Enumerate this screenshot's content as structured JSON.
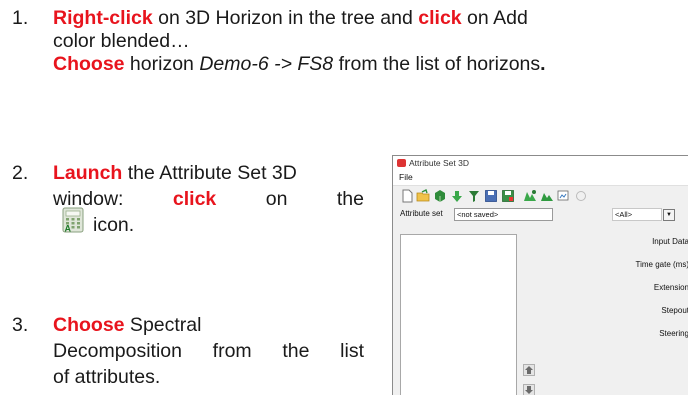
{
  "steps": [
    {
      "number": "1.",
      "line1": {
        "action1": "Right-click",
        "text1": " on 3D Horizon in the tree and ",
        "action2": "click",
        "text2": " on Add"
      },
      "line2": "color blended…",
      "line3": {
        "action": "Choose",
        "text1": " horizon ",
        "italic": "Demo-6 -> FS8",
        "text2": " from the list of horizons",
        "period": "."
      }
    },
    {
      "number": "2.",
      "line1": {
        "action": "Launch",
        "text": " the Attribute Set 3D"
      },
      "line2": {
        "w1": "window:",
        "action": "click",
        "w2": "on",
        "w3": "the"
      },
      "line3": "icon."
    },
    {
      "number": "3.",
      "line1": {
        "action": "Choose",
        "text": " Spectral"
      },
      "line2": {
        "w1": "Decomposition",
        "w2": "from",
        "w3": "the",
        "w4": "list"
      },
      "line3": "of attributes."
    }
  ],
  "icons": {
    "calculator": "attribute-calculator-icon"
  },
  "colors": {
    "accent_red": "#e8141d",
    "body_text": "#1a1a1a"
  },
  "window": {
    "title": "Attribute Set 3D",
    "menu": "File",
    "attribute_set_label": "Attribute set",
    "attribute_set_value": "<not saved>",
    "filter_value": "<All>",
    "params": [
      "Input Data",
      "Time gate (ms)",
      "Extension",
      "Stepout",
      "Steering"
    ]
  }
}
